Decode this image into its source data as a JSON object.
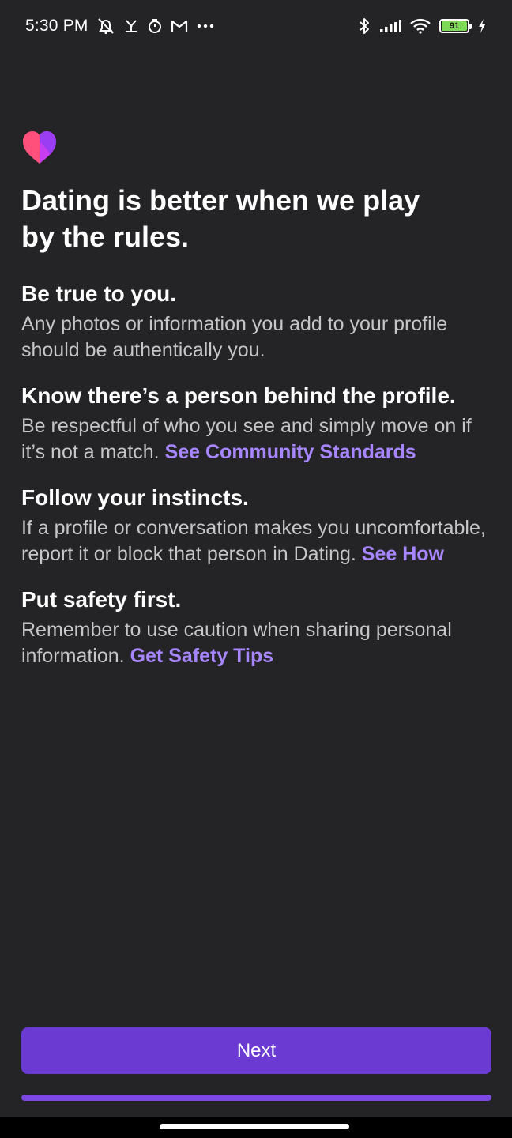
{
  "status_bar": {
    "time": "5:30 PM",
    "left_icons": [
      "alarm-off-icon",
      "network-icon",
      "timer-icon",
      "gmail-icon",
      "more-dots-icon"
    ],
    "right_icons": [
      "bluetooth-icon",
      "signal-icon",
      "wifi-icon",
      "battery-icon",
      "charging-icon"
    ],
    "battery_level": "91"
  },
  "logo": {
    "icon": "dating-heart-icon",
    "colors": [
      "#ff4f7b",
      "#a23cf0"
    ]
  },
  "page": {
    "title": "Dating is better when we play by the rules."
  },
  "rules": [
    {
      "heading": "Be true to you.",
      "body": "Any photos or information you add to your profile should be authentically you.",
      "link": ""
    },
    {
      "heading": "Know there’s a person behind the profile.",
      "body": "Be respectful of who you see and simply move on if it’s not a match.",
      "link": "See Community Standards"
    },
    {
      "heading": "Follow your instincts.",
      "body": "If a profile or conversation makes you uncomfortable, report it or block that person in Dating.",
      "link": "See How"
    },
    {
      "heading": "Put safety first.",
      "body": "Remember to use caution when sharing personal information.",
      "link": "Get Safety Tips"
    }
  ],
  "footer": {
    "next_label": "Next",
    "progress": 1.0
  },
  "colors": {
    "background": "#242427",
    "accent": "#6a3ad2",
    "link": "#a786ff",
    "body_text": "#c6c6c9"
  }
}
